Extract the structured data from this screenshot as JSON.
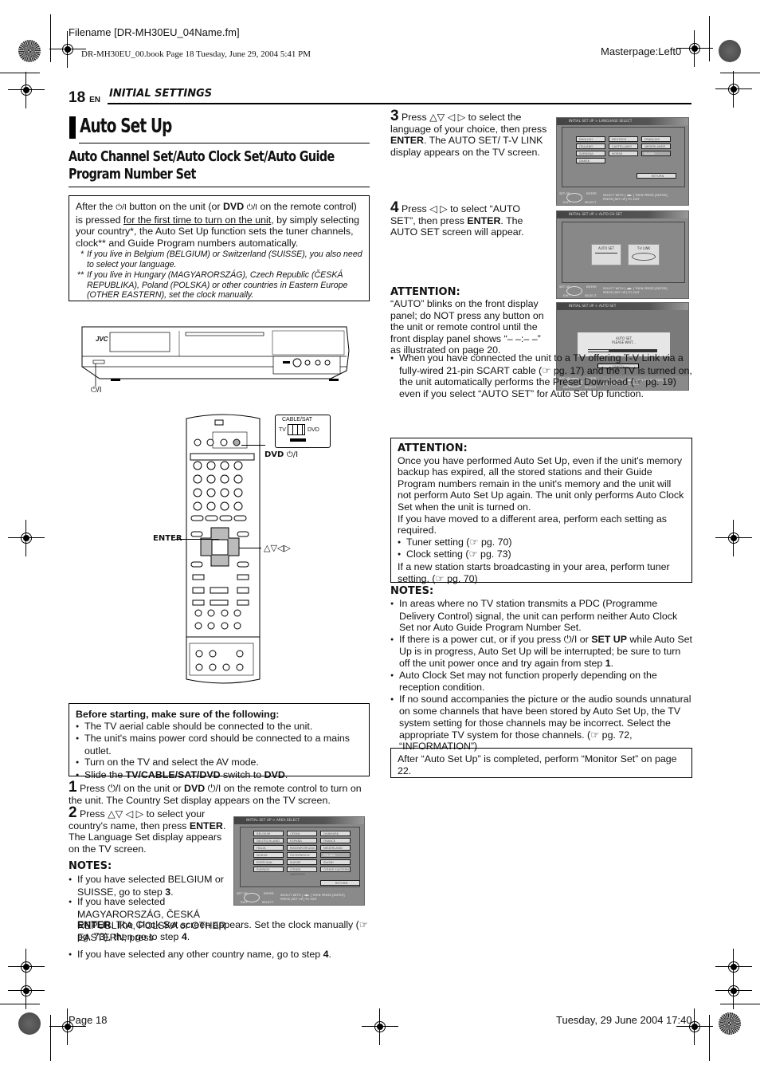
{
  "print_meta": {
    "filename": "Filename [DR-MH30EU_04Name.fm]",
    "book_line": "DR-MH30EU_00.book  Page 18  Tuesday, June 29, 2004  5:41 PM",
    "masterpage": "Masterpage:Left0",
    "footer_page": "Page 18",
    "footer_date": "Tuesday, 29 June 2004  17:40"
  },
  "header": {
    "page_number": "18",
    "lang": "EN",
    "section": "INITIAL SETTINGS"
  },
  "title": "Auto Set Up",
  "subtitle": "Auto Channel Set/Auto Clock Set/Auto Guide Program Number Set",
  "intro": {
    "p1_a": "After the ",
    "power_symbol": "⏻/I",
    "p1_b": " button on the unit (or ",
    "dvd": "DVD",
    "p1_c": " on the remote control) is pressed ",
    "p1_u": "for the first time to turn on the unit",
    "p1_d": ", by simply selecting your country*, the Auto Set Up function sets the tuner channels, clock** and Guide Program numbers automatically.",
    "fn1_mark": "*",
    "fn1": "If you live in Belgium (BELGIUM) or Switzerland (SUISSE), you also need to select your language.",
    "fn2_mark": "**",
    "fn2": "If you live in Hungary (MAGYARORSZÁG), Czech Republic (ČESKÁ REPUBLIKA), Poland (POLSKA) or other countries in Eastern Europe (OTHER EASTERN), set the clock manually."
  },
  "figures": {
    "unit_brand": "JVC",
    "unit_power_label": "⏻/I",
    "switch_label": "CABLE/SAT",
    "switch_tv": "TV",
    "switch_dvd": "DVD",
    "callout_dvd": "DVD",
    "callout_dvd_power": "⏻/I",
    "callout_enter": "ENTER",
    "callout_arrows": "△▽◁▷"
  },
  "before": {
    "heading": "Before starting, make sure of the following:",
    "items": [
      "The TV aerial cable should be connected to the unit.",
      "The unit's mains power cord should be connected to a mains outlet.",
      "Turn on the TV and select the AV mode."
    ],
    "last_a": "Slide the ",
    "last_b": "TV/CABLE/SAT/DVD",
    "last_c": " switch to ",
    "last_d": "DVD",
    "last_e": "."
  },
  "steps": {
    "s1_num": "1",
    "s1_a": " Press ⏻/I on the unit or ",
    "s1_b": "DVD",
    "s1_c": " ⏻/I on the remote control to turn on the unit. The Country Set display appears on the TV screen.",
    "s2_num": "2",
    "s2_a": " Press △▽ ◁ ▷ to select your country's name, then press ",
    "s2_b": "ENTER",
    "s2_c": ". The Language Set display appears on the TV screen.",
    "s3_num": "3",
    "s3_a": " Press △▽ ◁ ▷ to select the language of your choice, then press ",
    "s3_b": "ENTER",
    "s3_c": ". The AUTO SET/ T-V LINK display appears on the TV screen.",
    "s4_num": "4",
    "s4_a": " Press ◁ ▷ to select “AUTO SET”, then press ",
    "s4_b": "ENTER",
    "s4_c": ". The AUTO SET screen will appear."
  },
  "notes_left": {
    "heading": "NOTES:",
    "n1_a": "If you have selected BELGIUM or SUISSE, go to step ",
    "n1_b": "3",
    "n1_c": ".",
    "n2_a": "If you have selected MAGYARORSZÁG, ČESKÁ REPUBLIKA, POLSKA or OTHER EASTERN, press ",
    "n2_b": "ENTER",
    "n2_c": ". The Clock Set screen appears. Set the clock manually (☞ pg. 73), then go to step ",
    "n2_d": "4",
    "n2_e": ".",
    "n3_a": "If you have selected any other country name, go to step ",
    "n3_b": "4",
    "n3_c": "."
  },
  "attention1": {
    "heading": "ATTENTION:",
    "text": "“AUTO” blinks on the front display panel; do NOT press any button on the unit or remote control until the front display panel shows “– –:– –” as illustrated on page 20.",
    "bullet": "When you have connected the unit to a TV offering T-V Link via a fully-wired 21-pin SCART cable (☞ pg. 17) and the TV is turned on, the unit automatically performs the Preset Download (☞ pg. 19) even if you select “AUTO SET” for Auto Set Up function."
  },
  "attention2": {
    "heading": "ATTENTION:",
    "p1": "Once you have performed Auto Set Up, even if the unit's memory backup has expired, all the stored stations and their Guide Program numbers remain in the unit's memory and the unit will not perform Auto Set Up again. The unit only performs Auto Clock Set when the unit is turned on.",
    "p2": "If you have moved to a different area, perform each setting as required.",
    "items": [
      "Tuner setting (☞ pg. 70)",
      "Clock setting (☞ pg. 73)"
    ],
    "p3": "If a new station starts broadcasting in your area, perform tuner setting. (☞ pg. 70)"
  },
  "notes_right": {
    "heading": "NOTES:",
    "n1": "In areas where no TV station transmits a PDC (Programme Delivery Control) signal, the unit can perform neither Auto Clock Set nor Auto Guide Program Number Set.",
    "n2_a": "If there is a power cut, or if you press ⏻/I or ",
    "n2_b": "SET UP",
    "n2_c": " while Auto Set Up is in progress, Auto Set Up will be interrupted; be sure to turn off the unit power once and try again from step ",
    "n2_d": "1",
    "n2_e": ".",
    "n3": "Auto Clock Set may not function properly depending on the reception condition.",
    "n4": "If no sound accompanies the picture or the audio sounds unnatural on some channels that have been stored by Auto Set Up, the TV system setting for those channels may be incorrect. Select the appropriate TV system for those channels. (☞ pg. 72, “INFORMATION”)"
  },
  "final_box": "After “Auto Set Up” is completed, perform “Monitor Set” on page 22.",
  "screens": {
    "footer_setup": "SET UP",
    "footer_enter": "ENTER",
    "footer_exit": "EXIT",
    "footer_select": "SELECT",
    "footer_line1": "SELECT WITH [ ◂◆▸ ] THEN PRESS [ENTER]",
    "footer_line2": "PRESS [SET UP] TO EXIT",
    "area": {
      "title": "INITIAL SET UP > AREA SELECT",
      "options": [
        "BELGIUM",
        "ČESKÁ",
        "DANMARK",
        "DEUTSCHLAND",
        "ESPAÑA",
        "FRANCE",
        "ITALIA",
        "MAGYARORSZÁG",
        "NEDERLAND",
        "NORGE",
        "ÖSTERREICH",
        "POLSKA",
        "PORTUGAL",
        "SUISSE",
        "SUOMI",
        "SVERIGE",
        "OTHER WESTERN",
        "OTHER EASTERN"
      ],
      "selected": "POLSKA",
      "return": "RETURN"
    },
    "language": {
      "title": "INITIAL SET UP > LANGUAGE SELECT",
      "options": [
        "ENGLISH",
        "DEUTSCH",
        "FRANÇAIS",
        "ITALIANO",
        "CASTELLANO",
        "NEDERLANDS",
        "SVENSKA",
        "NORSK",
        "SUOMI",
        "DANSK"
      ],
      "selected": "SUOMI",
      "return": "RETURN"
    },
    "autoch": {
      "title": "INITIAL SET UP > AUTO CH SET",
      "opt1": "AUTO SET",
      "opt2": "T-V LINK"
    },
    "autoset": {
      "title": "INITIAL SET UP > AUTO SET",
      "msg1": "AUTO SET",
      "msg2": "PLEASE WAIT...",
      "progress": 0.3,
      "cancel": "CANCEL"
    }
  }
}
